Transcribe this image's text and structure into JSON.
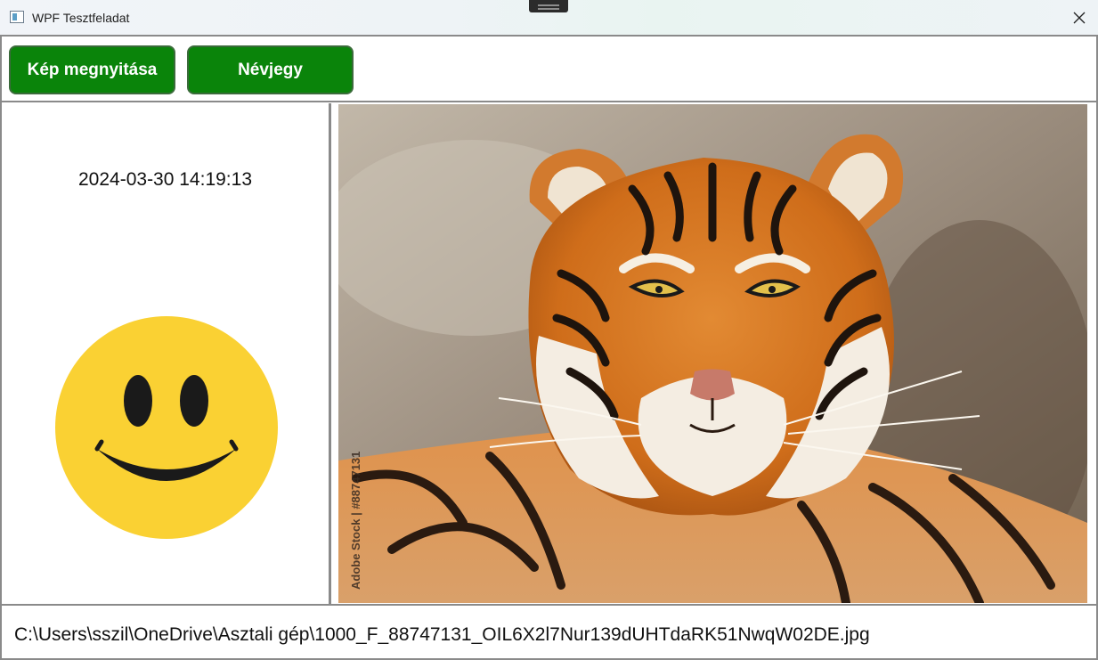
{
  "window": {
    "title": "WPF Tesztfeladat"
  },
  "toolbar": {
    "open_label": "Kép megnyitása",
    "about_label": "Névjegy"
  },
  "left_panel": {
    "datetime": "2024-03-30 14:19:13"
  },
  "image": {
    "watermark_text": "Adobe Stock | #88747131"
  },
  "status": {
    "file_path": "C:\\Users\\sszil\\OneDrive\\Asztali gép\\1000_F_88747131_OIL6X2l7Nur139dUHTdaRK51NwqW02DE.jpg"
  },
  "colors": {
    "button_green": "#0a840a",
    "smiley_yellow": "#fad133",
    "tiger_orange": "#d9761f"
  }
}
